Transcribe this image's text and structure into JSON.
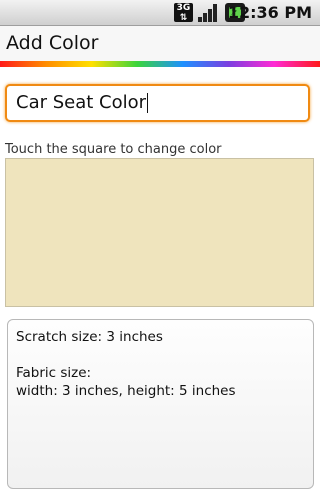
{
  "status_bar": {
    "network_label": "3G",
    "time": "12:36 PM"
  },
  "title_bar": {
    "title": "Add Color"
  },
  "form": {
    "name_value": "Car Seat Color",
    "hint": "Touch the square to change color",
    "swatch_color": "#efe4bd"
  },
  "info": {
    "scratch_size": "Scratch size: 3 inches",
    "fabric_heading": "Fabric size:",
    "fabric_dims": "width: 3 inches, height: 5 inches"
  },
  "colors": {
    "accent_focus": "#f08a12",
    "swatch": "#efe4bd"
  }
}
